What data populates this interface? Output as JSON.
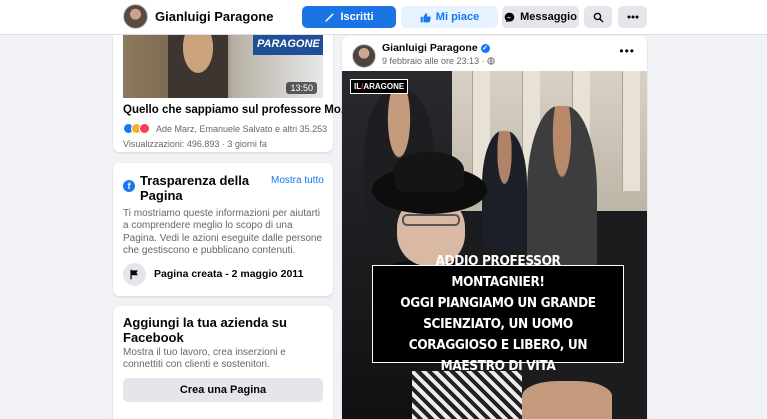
{
  "header": {
    "page_name": "Gianluigi Paragone",
    "buttons": {
      "subscribe": "Iscritti",
      "like": "Mi piace",
      "message": "Messaggio"
    }
  },
  "video_card": {
    "thumb_banner": "PARAGONE",
    "duration": "13:50",
    "title": "Quello che sappiamo sul professore Mo...",
    "reactions_text": "Ade Marz, Emanuele Salvato e altri 35.253",
    "views": "Visualizzazioni: 496.893 · 3 giorni fa"
  },
  "transparency": {
    "title": "Trasparenza della Pagina",
    "show_all": "Mostra tutto",
    "description": "Ti mostriamo queste informazioni per aiutarti a comprendere meglio lo scopo di una Pagina. Vedi le azioni eseguite dalle persone che gestiscono e pubblicano contenuti.",
    "created": "Pagina creata - 2 maggio 2011"
  },
  "business": {
    "title": "Aggiungi la tua azienda su Facebook",
    "description": "Mostra il tuo lavoro, crea inserzioni e connettiti con clienti e sostenitori.",
    "button": "Crea una Pagina"
  },
  "post": {
    "author": "Gianluigi Paragone",
    "date": "9 febbraio alle ore 23:13 ·",
    "logo_prefix": "IL",
    "logo_suffix": "ARAGONE",
    "caption": "Addio professor Montagnier!\nOggi piangiamo un grande scienziato, un uomo coraggioso e libero, un maestro di vita"
  },
  "colors": {
    "accent": "#1877f2",
    "primary_button": "#1b74e4"
  }
}
